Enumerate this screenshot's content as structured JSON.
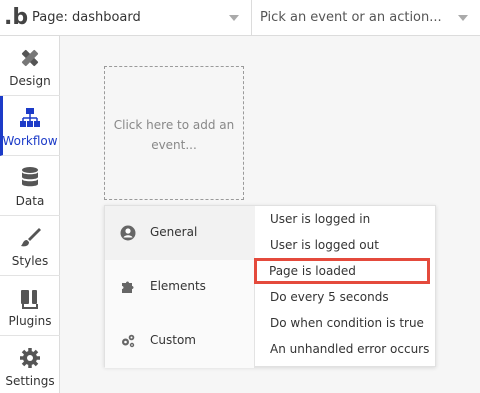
{
  "app": {
    "logo": ".b"
  },
  "header": {
    "page_select": "Page: dashboard",
    "event_select": "Pick an event or an action..."
  },
  "nav": {
    "items": [
      {
        "label": "Design",
        "icon": "design-icon"
      },
      {
        "label": "Workflow",
        "icon": "workflow-icon"
      },
      {
        "label": "Data",
        "icon": "database-icon"
      },
      {
        "label": "Styles",
        "icon": "brush-icon"
      },
      {
        "label": "Plugins",
        "icon": "plug-icon"
      },
      {
        "label": "Settings",
        "icon": "gear-icon"
      }
    ],
    "active": "Workflow"
  },
  "canvas": {
    "add_event_text": "Click here to add an event..."
  },
  "event_menu": {
    "categories": [
      {
        "label": "General",
        "icon": "user-circle-icon"
      },
      {
        "label": "Elements",
        "icon": "puzzle-icon"
      },
      {
        "label": "Custom",
        "icon": "gears-icon"
      }
    ],
    "options": [
      "User is logged in",
      "User is logged out",
      "Page is loaded",
      "Do every 5 seconds",
      "Do when condition is true",
      "An unhandled error occurs"
    ],
    "highlighted": "Page is loaded"
  },
  "colors": {
    "accent": "#1c3bc8",
    "highlight": "#e44a3c"
  }
}
